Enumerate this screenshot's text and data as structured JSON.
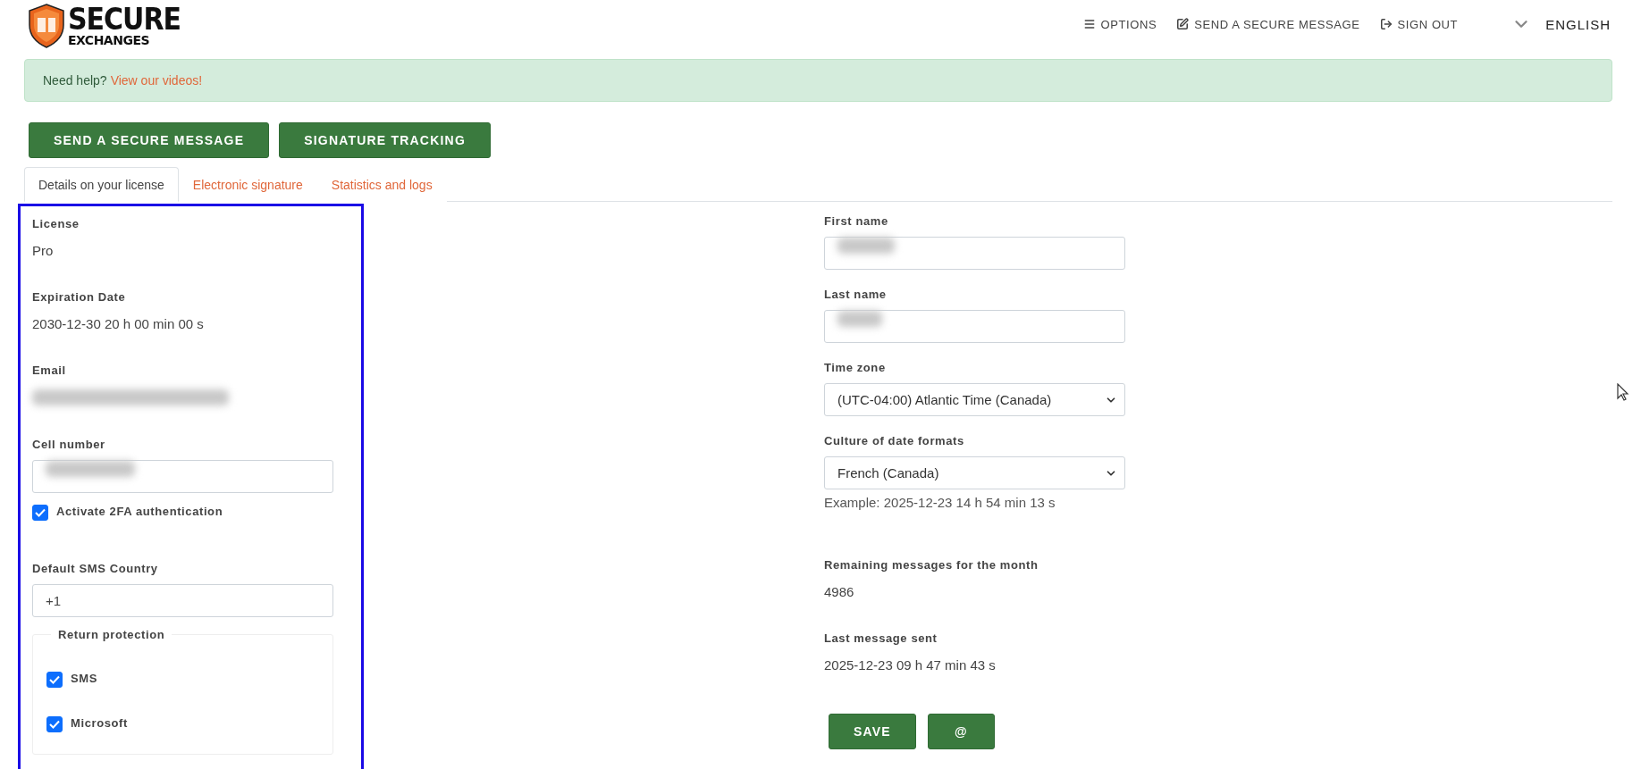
{
  "header": {
    "logo": {
      "line1": "SECURE",
      "line2": "EXCHANGES"
    },
    "nav": [
      {
        "kind": "menu",
        "label": "OPTIONS"
      },
      {
        "kind": "compose",
        "label": "SEND A SECURE MESSAGE"
      },
      {
        "kind": "signout",
        "label": "SIGN OUT"
      }
    ],
    "language": {
      "label": "ENGLISH"
    }
  },
  "help": {
    "text": "Need help?",
    "link": "View our videos!"
  },
  "action_buttons": [
    "SEND A SECURE MESSAGE",
    "SIGNATURE TRACKING"
  ],
  "tabs": [
    {
      "label": "Details on your license",
      "selected": true
    },
    {
      "label": "Electronic signature",
      "selected": false
    },
    {
      "label": "Statistics and logs",
      "selected": false
    }
  ],
  "left": {
    "license": {
      "label": "License",
      "value": "Pro"
    },
    "expiration": {
      "label": "Expiration Date",
      "value": "2030-12-30 20 h 00 min 00 s"
    },
    "email": {
      "label": "Email",
      "redacted": true
    },
    "cell": {
      "label": "Cell number",
      "redacted": true
    },
    "two_fa": {
      "label": "Activate 2FA authentication",
      "checked": true
    },
    "sms_country": {
      "label": "Default SMS Country",
      "value": "+1"
    },
    "return_protection": {
      "legend": "Return protection",
      "options": [
        {
          "label": "SMS",
          "checked": true
        },
        {
          "label": "Microsoft",
          "checked": true
        }
      ]
    }
  },
  "right": {
    "first_name": {
      "label": "First name",
      "redacted": true
    },
    "last_name": {
      "label": "Last name",
      "redacted": true
    },
    "time_zone": {
      "label": "Time zone",
      "value": "(UTC-04:00) Atlantic Time (Canada)"
    },
    "date_culture": {
      "label": "Culture of date formats",
      "value": "French (Canada)",
      "example": "Example: 2025-12-23 14 h 54 min 13 s"
    },
    "remaining": {
      "label": "Remaining messages for the month",
      "value": "4986"
    },
    "last_sent": {
      "label": "Last message sent",
      "value": "2025-12-23 09 h 47 min 43 s"
    },
    "buttons": [
      "SAVE",
      "@"
    ]
  }
}
